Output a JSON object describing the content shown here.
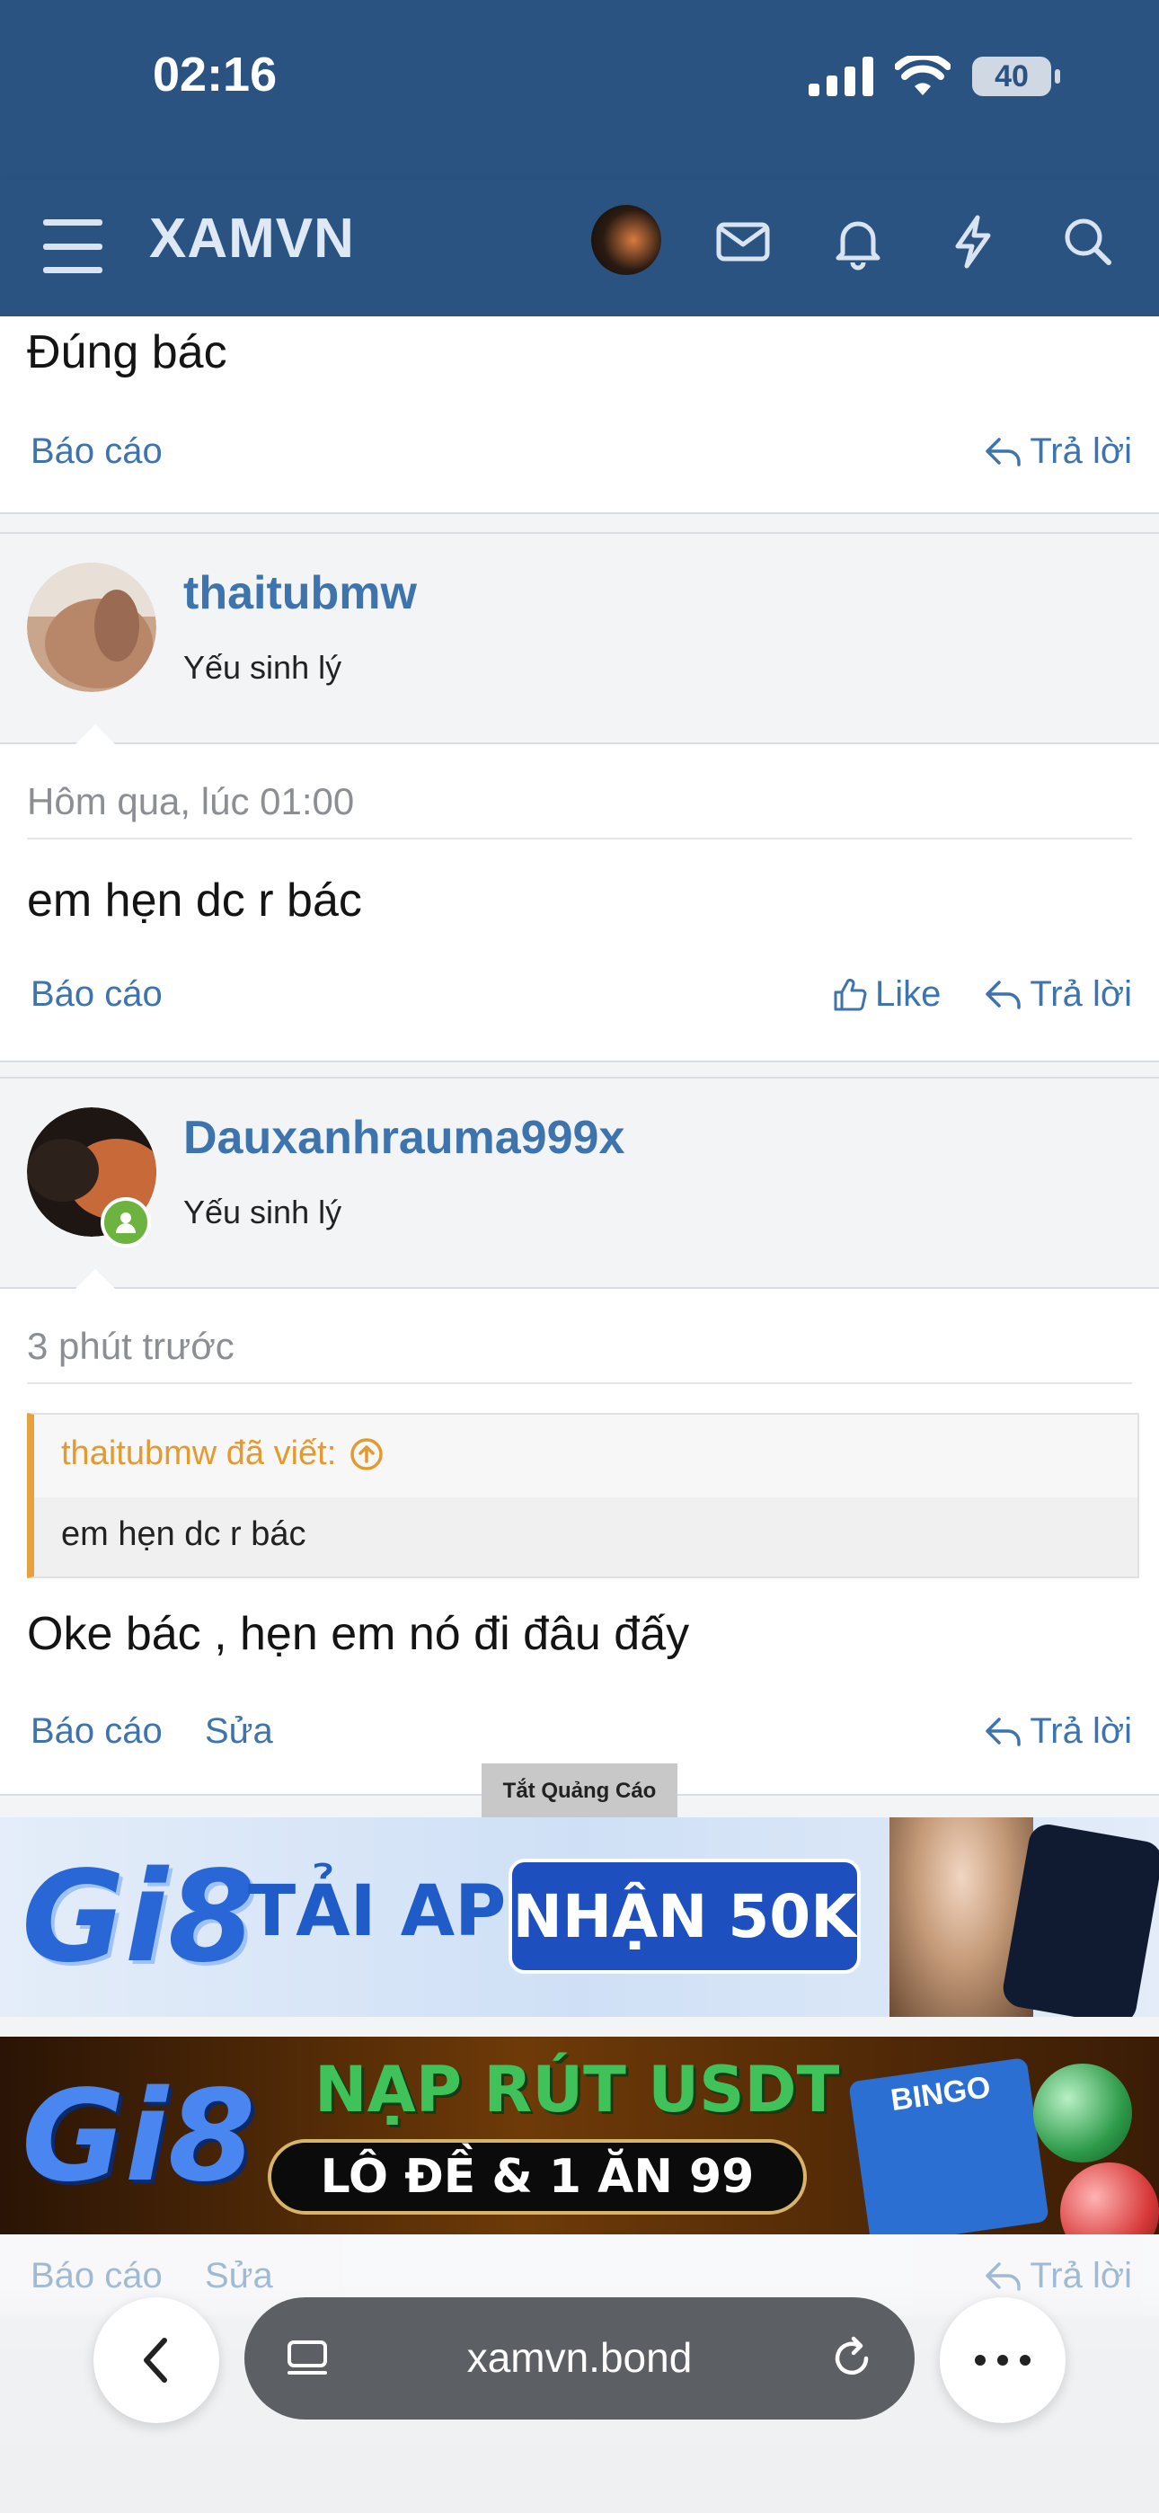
{
  "status_bar": {
    "time": "02:16",
    "battery": "40"
  },
  "nav": {
    "brand": "XAMVN"
  },
  "post1": {
    "text": "Đúng bác",
    "report": "Báo cáo",
    "reply": "Trả lời"
  },
  "post2": {
    "username": "thaitubmw",
    "rank": "Yếu sinh lý",
    "time": "Hôm qua, lúc 01:00",
    "text": "em hẹn dc r bác",
    "report": "Báo cáo",
    "like": "Like",
    "reply": "Trả lời"
  },
  "post3": {
    "username": "Dauxanhrauma999x",
    "rank": "Yếu sinh lý",
    "time": "3 phút trước",
    "quote_author": "thaitubmw đã viết:",
    "quote_text": "em hẹn dc r bác",
    "text": "Oke bác , hẹn em nó đi đâu đấy",
    "report": "Báo cáo",
    "edit": "Sửa",
    "reply": "Trả lời"
  },
  "ads": {
    "label": "Tắt Quảng Cáo",
    "ad1_logo": "Gi8",
    "ad1_text": "TẢI APP",
    "ad1_badge": "NHẬN 50K",
    "ad2_logo": "Gi8",
    "ad2_top": "NẠP RÚT USDT",
    "ad2_bottom": "LÔ ĐỀ & 1 ĂN 99",
    "ad2_tag": "BINGO"
  },
  "faded_actions": {
    "report": "Báo cáo",
    "edit": "Sửa",
    "reply": "Trả lời"
  },
  "browser": {
    "url": "xamvn.bond"
  },
  "colors": {
    "brand_blue": "#2b5382",
    "link_blue": "#3e74ad",
    "quote_orange": "#e8a13c",
    "online_green": "#6cb33f"
  }
}
